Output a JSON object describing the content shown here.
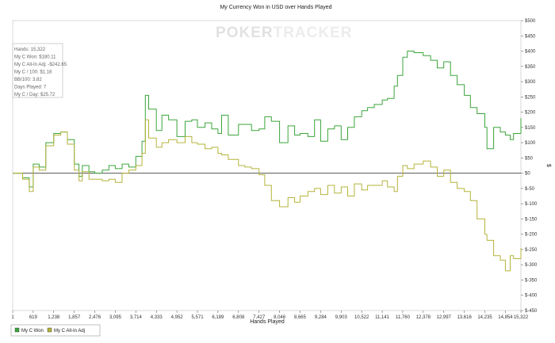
{
  "chart_data": {
    "type": "line",
    "title": "My Currency Won in USD over Hands Played",
    "xlabel": "Hands Played",
    "ylabel": "$",
    "xlim": [
      1,
      15322
    ],
    "ylim": [
      -450,
      500
    ],
    "x_ticks": [
      1,
      619,
      1238,
      1857,
      2476,
      3095,
      3714,
      4333,
      4952,
      5571,
      6189,
      6808,
      7427,
      8046,
      8665,
      9284,
      9903,
      10522,
      11141,
      11760,
      12378,
      12997,
      13616,
      14235,
      14854,
      15322
    ],
    "x_tick_labels": [
      "1",
      "619",
      "1,238",
      "1,857",
      "2,476",
      "3,095",
      "3,714",
      "4,333",
      "4,952",
      "5,571",
      "6,189",
      "6,808",
      "7,427",
      "8,046",
      "8,665",
      "9,284",
      "9,903",
      "10,522",
      "11,141",
      "11,760",
      "12,378",
      "12,997",
      "13,616",
      "14,235",
      "14,854",
      "15,322"
    ],
    "y_ticks": [
      500,
      450,
      400,
      350,
      300,
      250,
      200,
      150,
      100,
      50,
      0,
      -50,
      -100,
      -150,
      -200,
      -250,
      -300,
      -350,
      -400,
      -450
    ],
    "y_tick_labels": [
      "$500",
      "$450",
      "$400",
      "$350",
      "$300",
      "$250",
      "$200",
      "$150",
      "$100",
      "$50",
      "$0",
      "$-50",
      "$-100",
      "$-150",
      "$-200",
      "$-250",
      "$-300",
      "$-350",
      "$-400",
      "$-450"
    ],
    "grid": false,
    "legend_position": "bottom-left",
    "series": [
      {
        "name": "My C Won",
        "color": "#3aa53a",
        "x": [
          1,
          300,
          500,
          619,
          800,
          1000,
          1238,
          1450,
          1650,
          1857,
          2000,
          2100,
          2300,
          2476,
          2700,
          2900,
          3095,
          3300,
          3500,
          3714,
          3900,
          4000,
          4100,
          4333,
          4500,
          4700,
          4952,
          5200,
          5400,
          5571,
          5800,
          6000,
          6189,
          6300,
          6500,
          6808,
          7000,
          7200,
          7427,
          7600,
          7800,
          8046,
          8300,
          8500,
          8665,
          8900,
          9100,
          9284,
          9500,
          9700,
          9903,
          10100,
          10300,
          10522,
          10700,
          10900,
          11141,
          11300,
          11500,
          11600,
          11760,
          11900,
          12100,
          12378,
          12600,
          12800,
          12997,
          13200,
          13400,
          13616,
          13800,
          14000,
          14235,
          14300,
          14500,
          14700,
          14854,
          15000,
          15100,
          15322
        ],
        "values": [
          0,
          -15,
          -45,
          30,
          20,
          100,
          130,
          135,
          110,
          30,
          -10,
          25,
          5,
          0,
          10,
          25,
          15,
          30,
          20,
          55,
          105,
          255,
          210,
          140,
          190,
          175,
          120,
          170,
          175,
          150,
          165,
          145,
          130,
          190,
          125,
          160,
          160,
          140,
          145,
          185,
          170,
          100,
          155,
          125,
          130,
          120,
          175,
          105,
          145,
          155,
          110,
          150,
          185,
          205,
          215,
          225,
          240,
          245,
          285,
          320,
          380,
          400,
          395,
          385,
          370,
          345,
          365,
          320,
          290,
          255,
          215,
          195,
          150,
          80,
          150,
          135,
          125,
          110,
          130,
          180
        ]
      },
      {
        "name": "My C All-In Adj",
        "color": "#b5b33a",
        "x": [
          1,
          300,
          500,
          619,
          800,
          1000,
          1238,
          1450,
          1650,
          1857,
          2000,
          2100,
          2300,
          2476,
          2700,
          2900,
          3095,
          3300,
          3500,
          3714,
          3900,
          4000,
          4100,
          4333,
          4500,
          4700,
          4952,
          5200,
          5400,
          5571,
          5800,
          6000,
          6189,
          6300,
          6500,
          6808,
          7000,
          7200,
          7427,
          7600,
          7800,
          8046,
          8300,
          8500,
          8665,
          8900,
          9100,
          9284,
          9500,
          9700,
          9903,
          10100,
          10300,
          10522,
          10700,
          10900,
          11141,
          11300,
          11500,
          11600,
          11760,
          11900,
          12100,
          12378,
          12600,
          12800,
          12997,
          13200,
          13400,
          13616,
          13800,
          14000,
          14235,
          14300,
          14500,
          14700,
          14854,
          15000,
          15100,
          15322
        ],
        "values": [
          0,
          -20,
          -60,
          20,
          10,
          90,
          125,
          135,
          95,
          10,
          -25,
          5,
          -20,
          -20,
          -25,
          -20,
          -30,
          0,
          10,
          25,
          65,
          175,
          115,
          85,
          100,
          110,
          100,
          120,
          100,
          95,
          80,
          85,
          65,
          60,
          45,
          25,
          20,
          15,
          -5,
          -40,
          -90,
          -110,
          -80,
          -95,
          -75,
          -60,
          -50,
          -70,
          -40,
          -65,
          -45,
          -75,
          -35,
          -55,
          -40,
          -40,
          -25,
          -45,
          -60,
          -10,
          25,
          15,
          30,
          40,
          20,
          -10,
          10,
          -30,
          -50,
          -60,
          -90,
          -150,
          -200,
          -220,
          -270,
          -285,
          -320,
          -270,
          -280,
          -245
        ]
      }
    ]
  },
  "watermark": {
    "part1": "P",
    "ring": "O",
    "part2": "KER",
    "part3": "TRACKER"
  },
  "stats": [
    "Hands: 15,322",
    "My C Won: $180.11",
    "My C All-In Adj: -$242.65",
    "My C / 100: $1.18",
    "BB/100: 3.82",
    "Days Played: 7",
    "My C / Day: $25.72"
  ]
}
